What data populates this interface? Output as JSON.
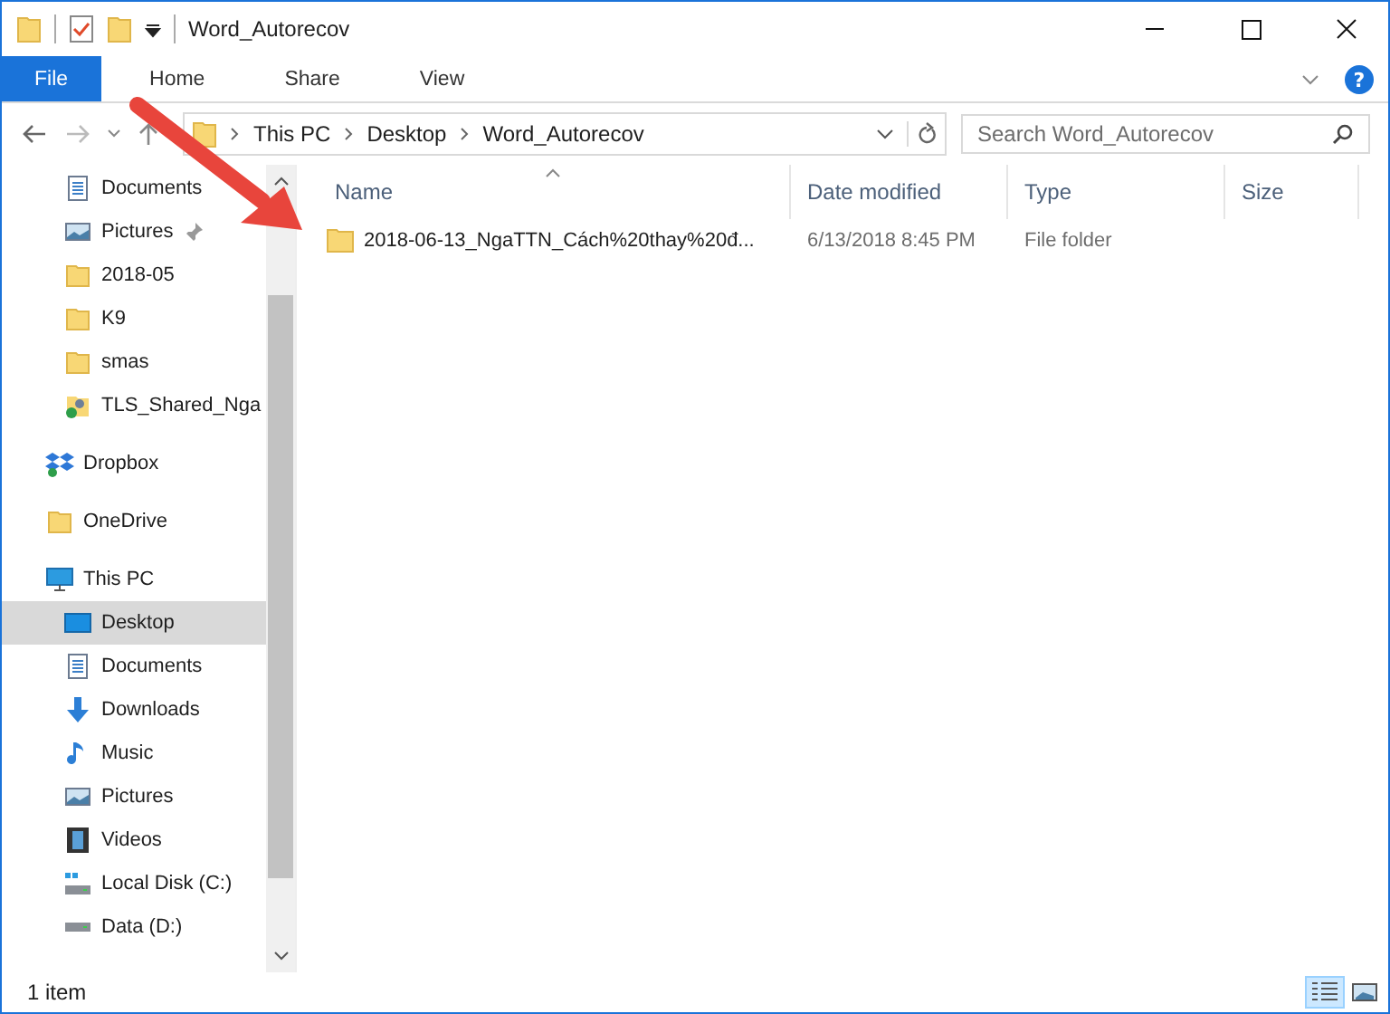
{
  "window": {
    "title": "Word_Autorecov"
  },
  "ribbon": {
    "help": "?",
    "tabs": [
      {
        "label": "File",
        "selected": true
      },
      {
        "label": "Home",
        "selected": false
      },
      {
        "label": "Share",
        "selected": false
      },
      {
        "label": "View",
        "selected": false
      }
    ]
  },
  "address_bar": {
    "crumbs": [
      "This PC",
      "Desktop",
      "Word_Autorecov"
    ]
  },
  "search": {
    "placeholder": "Search Word_Autorecov"
  },
  "sidebar": {
    "quick_access_items": [
      {
        "label": "Documents",
        "kind": "documents",
        "pinned": false,
        "selected": false
      },
      {
        "label": "Pictures",
        "kind": "pictures",
        "pinned": true,
        "selected": false
      },
      {
        "label": "2018-05",
        "kind": "folder",
        "pinned": false,
        "selected": false
      },
      {
        "label": "K9",
        "kind": "folder",
        "pinned": false,
        "selected": false
      },
      {
        "label": "smas",
        "kind": "folder",
        "pinned": false,
        "selected": false
      },
      {
        "label": "TLS_Shared_Nga",
        "kind": "shared",
        "pinned": false,
        "selected": false
      }
    ],
    "items": [
      {
        "label": "Dropbox",
        "kind": "dropbox",
        "selected": false
      },
      {
        "label": "OneDrive",
        "kind": "folder",
        "selected": false
      },
      {
        "label": "This PC",
        "kind": "pc",
        "selected": false,
        "children": [
          {
            "label": "Desktop",
            "kind": "desktop",
            "selected": true
          },
          {
            "label": "Documents",
            "kind": "documents",
            "selected": false
          },
          {
            "label": "Downloads",
            "kind": "downloads",
            "selected": false
          },
          {
            "label": "Music",
            "kind": "music",
            "selected": false
          },
          {
            "label": "Pictures",
            "kind": "pictures",
            "selected": false
          },
          {
            "label": "Videos",
            "kind": "videos",
            "selected": false
          },
          {
            "label": "Local Disk (C:)",
            "kind": "disk-win",
            "selected": false
          },
          {
            "label": "Data (D:)",
            "kind": "disk",
            "selected": false
          }
        ]
      }
    ]
  },
  "table": {
    "columns": [
      "Name",
      "Date modified",
      "Type",
      "Size"
    ],
    "rows": [
      {
        "name": "2018-06-13_NgaTTN_Cách%20thay%20đ...",
        "date_modified": "6/13/2018 8:45 PM",
        "type": "File folder",
        "size": ""
      }
    ]
  },
  "status_bar": {
    "text": "1 item",
    "views": [
      {
        "kind": "details",
        "selected": true
      },
      {
        "kind": "large-icons",
        "selected": false
      }
    ]
  }
}
